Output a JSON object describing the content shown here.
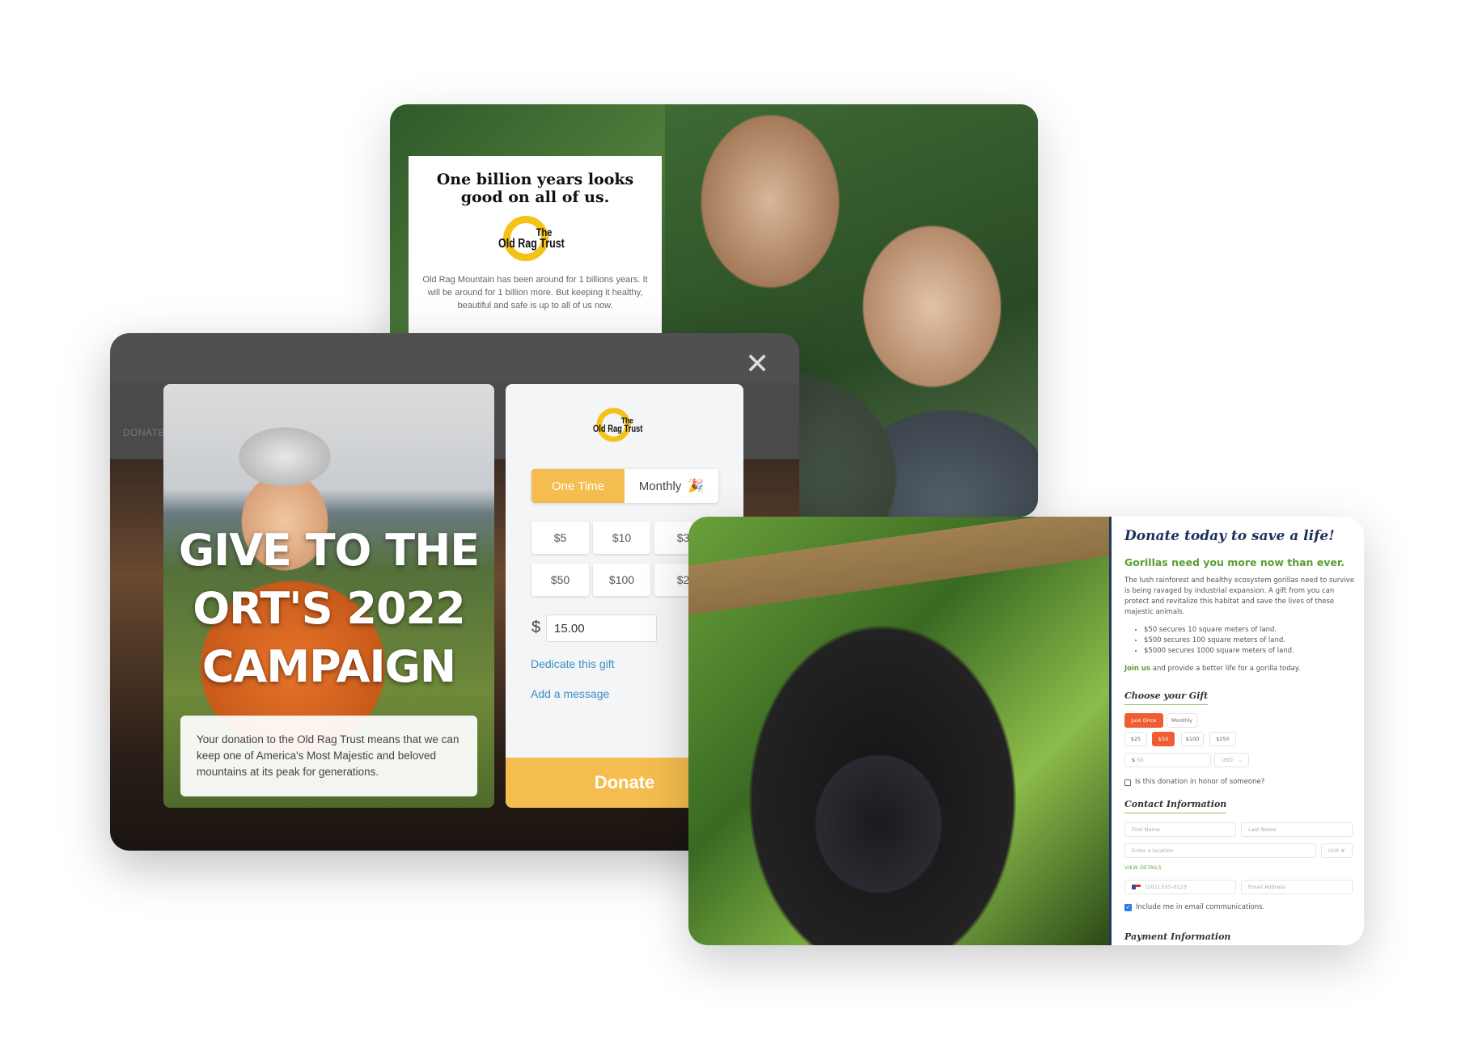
{
  "top_card": {
    "title": "One billion years looks good on all of us.",
    "logo": {
      "the": "The",
      "name": "Old Rag Trust"
    },
    "body": "Old Rag Mountain has been around for 1 billions years. It will be around for 1 billion more. But keeping it healthy, beautiful and safe is up to all of us now."
  },
  "modal": {
    "close_icon": "close-icon",
    "nav_item": "DONATE",
    "campaign_title": "GIVE TO THE ORT'S 2022 CAMPAIGN",
    "campaign_lines": [
      "GIVE TO THE",
      "ORT'S 2022",
      "CAMPAIGN"
    ],
    "caption": "Your donation to the Old Rag Trust means that we can keep one of America's Most Majestic and beloved mountains at its peak for generations.",
    "form": {
      "logo": {
        "the": "The",
        "name": "Old Rag Trust"
      },
      "frequency": [
        "One Time",
        "Monthly"
      ],
      "selected_frequency": "One Time",
      "monthly_icon": "party-popper-icon",
      "amounts": [
        "$5",
        "$10",
        "$3",
        "$50",
        "$100",
        "$2"
      ],
      "currency_symbol": "$",
      "amount_value": "15.00",
      "dedicate_link": "Dedicate this gift",
      "message_link": "Add a message",
      "donate_label": "Donate"
    },
    "accent": "#f5bd4f"
  },
  "gorilla_card": {
    "title": "Donate today to save a life!",
    "subtitle": "Gorillas need you more now than ever.",
    "intro": "The lush rainforest and healthy ecosystem gorillas need to survive is being ravaged by industrial expansion. A gift from you can protect and revitalize this habitat and save the lives of these majestic animals.",
    "bullets": [
      "$50 secures 10 square meters of land.",
      "$500 secures 100 square meters of land.",
      "$5000 secures 1000 square meters of land."
    ],
    "join_link": "Join us",
    "join_rest": " and provide a better life for a gorilla today.",
    "choose_gift": "Choose your Gift",
    "frequency": [
      "Just Once",
      "Monthly"
    ],
    "amounts": [
      "$25",
      "$50",
      "$100",
      "$250"
    ],
    "selected_amount": "$50",
    "amount_prefix": "$",
    "amount_value": "50",
    "currency": "USD",
    "honor_label": "Is this donation in honor of someone?",
    "honor_checked": false,
    "contact_heading": "Contact Information",
    "first_name_placeholder": "First Name",
    "last_name_placeholder": "Last Name",
    "location_placeholder": "Enter a location",
    "unit_placeholder": "Unit #",
    "view_details": "VIEW DETAILS",
    "phone_placeholder": "(201) 555-0123",
    "email_placeholder": "Email Address",
    "email_opt_in": "Include me in email communications.",
    "email_opt_in_checked": true,
    "payment_heading": "Payment Information",
    "accent": "#ef5e33",
    "green": "#5a9e2f"
  }
}
